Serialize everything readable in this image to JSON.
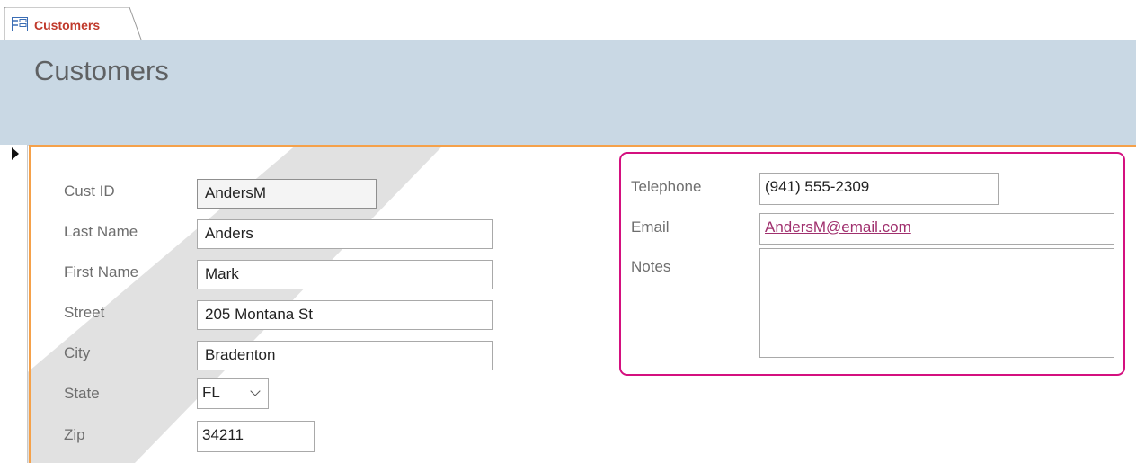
{
  "tab": {
    "label": "Customers",
    "icon": "form-icon"
  },
  "form": {
    "title": "Customers",
    "record_selector": "record-pointer-icon",
    "fields": {
      "cust_id": {
        "label": "Cust ID",
        "value": "AndersM"
      },
      "last_name": {
        "label": "Last Name",
        "value": "Anders"
      },
      "first_name": {
        "label": "First Name",
        "value": "Mark"
      },
      "street": {
        "label": "Street",
        "value": "205 Montana St"
      },
      "city": {
        "label": "City",
        "value": "Bradenton"
      },
      "state": {
        "label": "State",
        "value": "FL"
      },
      "zip": {
        "label": "Zip",
        "value": "34211"
      },
      "telephone": {
        "label": "Telephone",
        "value": "(941) 555-2309"
      },
      "email": {
        "label": "Email",
        "value": "AndersM@email.com"
      },
      "notes": {
        "label": "Notes",
        "value": ""
      }
    }
  },
  "colors": {
    "accent": "#f5a14a",
    "highlight": "#d4107f",
    "header_bg": "#c9d8e4",
    "tab_text": "#c0392b"
  }
}
